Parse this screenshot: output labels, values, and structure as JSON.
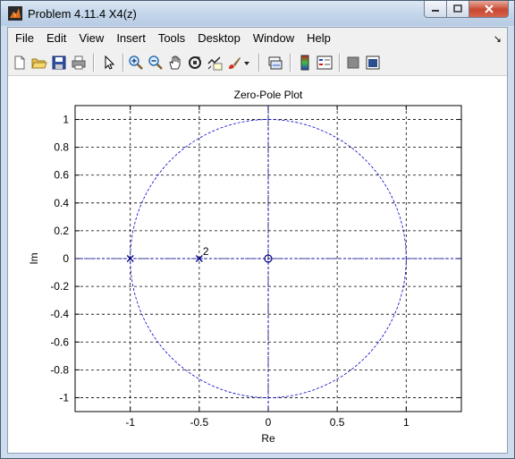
{
  "window": {
    "title": "Problem 4.11.4 X4(z)"
  },
  "menu": [
    "File",
    "Edit",
    "View",
    "Insert",
    "Tools",
    "Desktop",
    "Window",
    "Help"
  ],
  "toolbar": {
    "icons": [
      "new-file-icon",
      "open-folder-icon",
      "save-icon",
      "print-icon",
      "select-arrow-icon",
      "zoom-in-icon",
      "zoom-out-icon",
      "pan-hand-icon",
      "rotate-3d-icon",
      "data-cursor-icon",
      "brush-icon",
      "brush-dropdown-icon",
      "link-plot-icon",
      "colorbar-icon",
      "legend-icon",
      "hide-plot-tools-icon",
      "show-plot-tools-icon"
    ]
  },
  "chart_data": {
    "type": "scatter",
    "title": "Zero-Pole Plot",
    "xlabel": "Re",
    "ylabel": "Im",
    "xlim": [
      -1.4,
      1.4
    ],
    "ylim": [
      -1.1,
      1.1
    ],
    "xticks": [
      -1,
      -0.5,
      0,
      0.5,
      1
    ],
    "xtick_labels": [
      "-1",
      "-0.5",
      "0",
      "0.5",
      "1"
    ],
    "yticks": [
      1,
      0.8,
      0.6,
      0.4,
      0.2,
      0,
      -0.2,
      -0.4,
      -0.6,
      -0.8,
      -1
    ],
    "ytick_labels": [
      "1",
      "0.8",
      "0.6",
      "0.4",
      "0.2",
      "0",
      "-0.2",
      "-0.4",
      "-0.6",
      "-0.8",
      "-1"
    ],
    "grid": true,
    "unit_circle": true,
    "zeros": [
      {
        "re": 0,
        "im": 0
      }
    ],
    "poles": [
      {
        "re": -1,
        "im": 0
      },
      {
        "re": -0.5,
        "im": 0,
        "multiplicity_label": "2"
      }
    ],
    "colors": {
      "marker": "#00007f",
      "circle": "#0000cc",
      "grid": "#000000"
    }
  }
}
